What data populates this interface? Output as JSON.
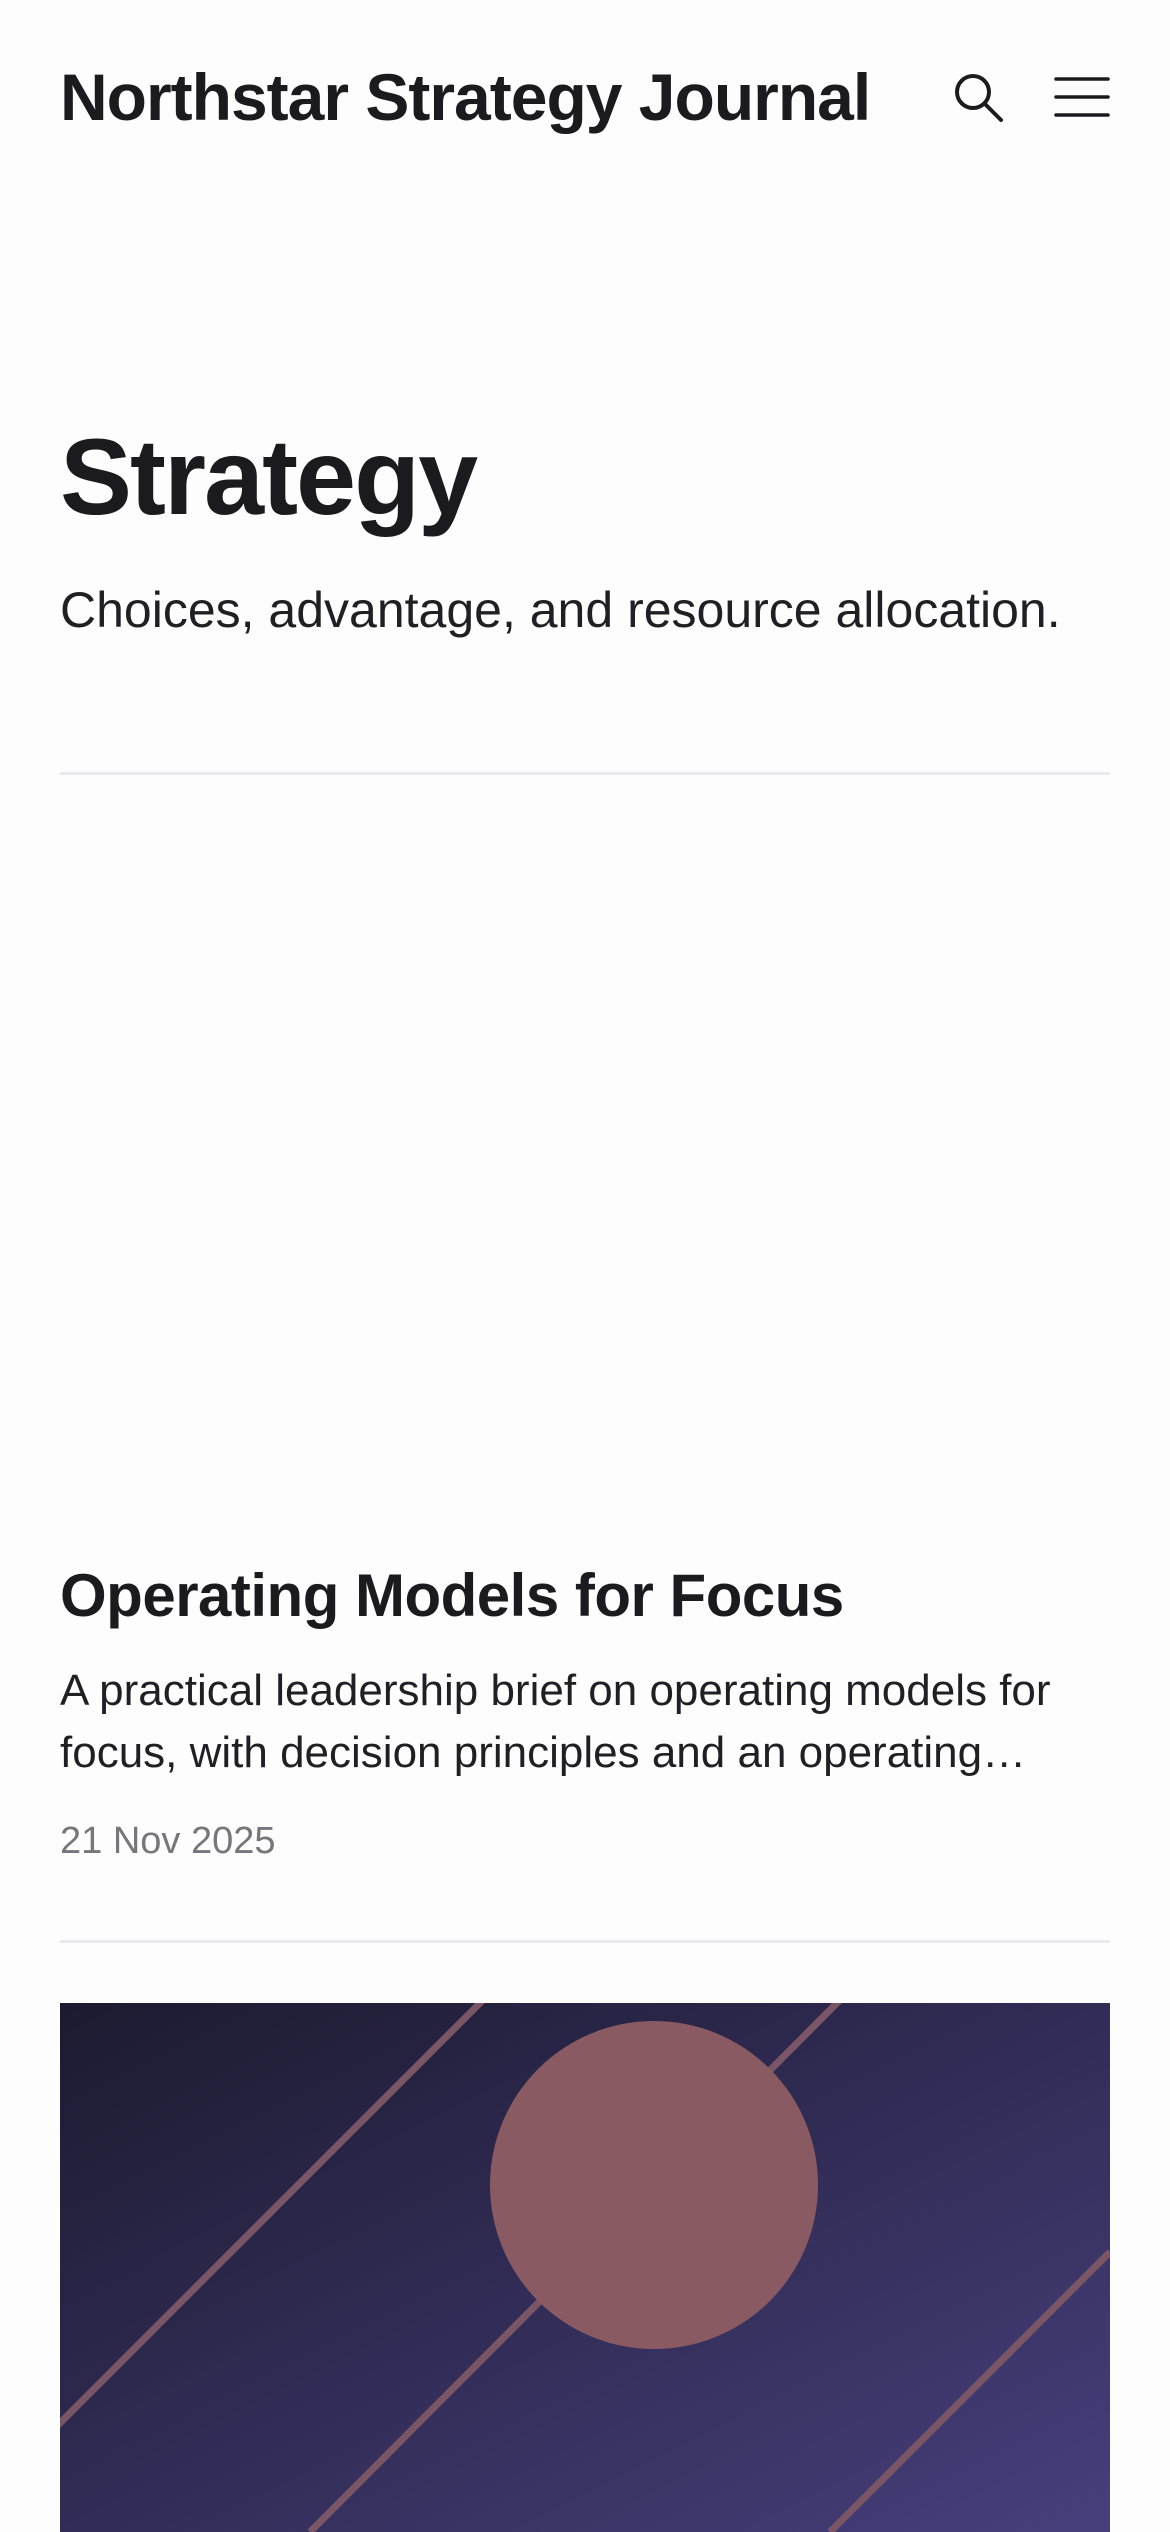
{
  "header": {
    "site_title": "Northstar Strategy Journal",
    "search_icon": "search-icon",
    "menu_icon": "hamburger-menu-icon"
  },
  "category": {
    "title": "Strategy",
    "description": "Choices, advantage, and resource allocation."
  },
  "articles": [
    {
      "title": "Operating Models for Focus",
      "excerpt": "A practical leadership brief on operating models for focus, with decision principles and an operating checklist.",
      "date": "21 Nov 2025"
    }
  ],
  "colors": {
    "text": "#1b1b1f",
    "muted": "#76767b",
    "divider": "#e9e8ea",
    "image_dark": "#1e1c33",
    "image_light": "#463f7a",
    "image_accent": "#8a5a62"
  }
}
